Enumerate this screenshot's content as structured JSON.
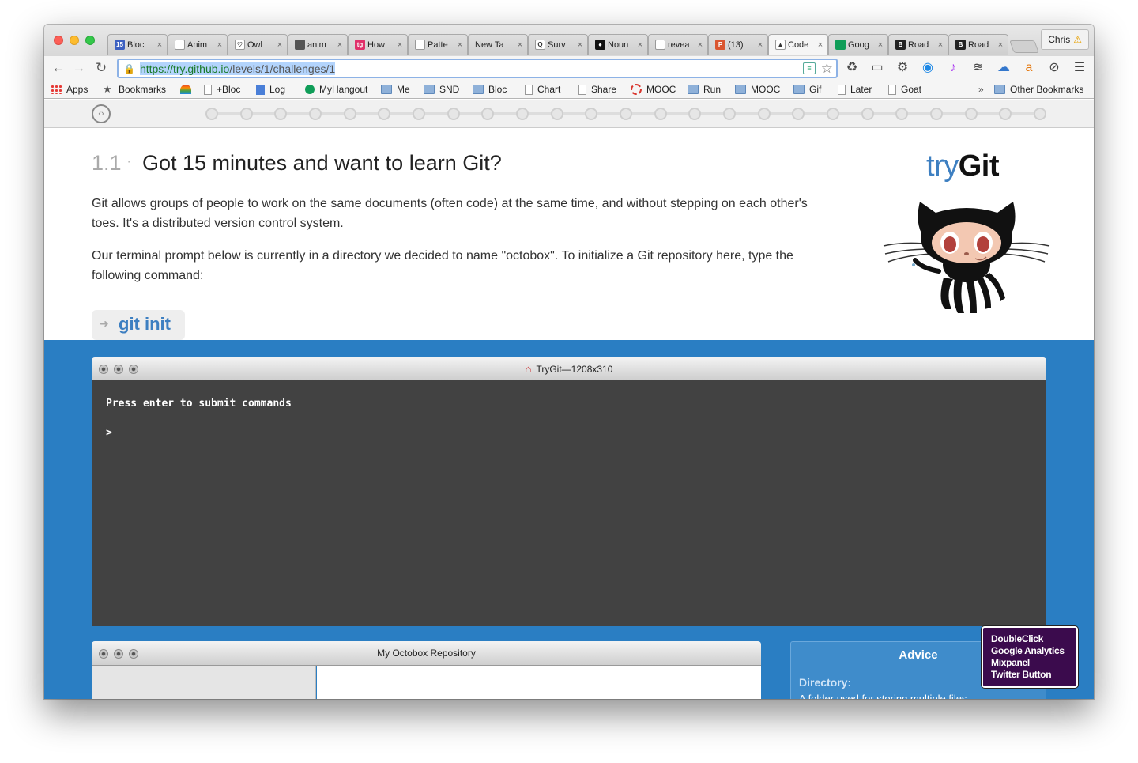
{
  "browser": {
    "tabs": [
      {
        "label": "Bloc",
        "icon": "calendar-15-icon",
        "color": "#3b5fc0",
        "glyph": "15"
      },
      {
        "label": "Anim",
        "icon": "page-icon",
        "color": "#ffffff",
        "glyph": ""
      },
      {
        "label": "Owl",
        "icon": "owl-icon",
        "color": "#ffffff",
        "glyph": "♡"
      },
      {
        "label": "anim",
        "icon": "grid-icon",
        "color": "#555555",
        "glyph": ""
      },
      {
        "label": "How",
        "icon": "tg-icon",
        "color": "#e0306a",
        "glyph": "tg"
      },
      {
        "label": "Patte",
        "icon": "page-icon",
        "color": "#ffffff",
        "glyph": ""
      },
      {
        "label": "New Ta",
        "icon": "none",
        "color": "",
        "glyph": ""
      },
      {
        "label": "Surv",
        "icon": "search-icon",
        "color": "#ffffff",
        "glyph": "Q"
      },
      {
        "label": "Noun",
        "icon": "noun-icon",
        "color": "#111111",
        "glyph": "●"
      },
      {
        "label": "revea",
        "icon": "page-icon",
        "color": "#ffffff",
        "glyph": ""
      },
      {
        "label": "(13)",
        "icon": "producthunt-icon",
        "color": "#da552f",
        "glyph": "P"
      },
      {
        "label": "Code",
        "icon": "octocat-icon",
        "color": "#ffffff",
        "glyph": "▲",
        "active": true
      },
      {
        "label": "Goog",
        "icon": "hangouts-icon",
        "color": "#0f9d58",
        "glyph": ""
      },
      {
        "label": "Road",
        "icon": "bloc-b-icon",
        "color": "#222222",
        "glyph": "B"
      },
      {
        "label": "Road",
        "icon": "bloc-b-icon",
        "color": "#222222",
        "glyph": "B"
      }
    ],
    "profile_name": "Chris",
    "url_host": "https://try.github.io",
    "url_path": "/levels/1/challenges/1",
    "bookmarks": [
      {
        "label": "Apps",
        "icon": "apps-grid-icon"
      },
      {
        "label": "Bookmarks",
        "icon": "star-icon"
      },
      {
        "label": "",
        "icon": "rainbow-icon"
      },
      {
        "label": "+Bloc",
        "icon": "page-icon"
      },
      {
        "label": "Log",
        "icon": "doc-icon"
      },
      {
        "label": "MyHangout",
        "icon": "hangouts-icon"
      },
      {
        "label": "Me",
        "icon": "folder-icon"
      },
      {
        "label": "SND",
        "icon": "folder-icon"
      },
      {
        "label": "Bloc",
        "icon": "folder-icon"
      },
      {
        "label": "Chart",
        "icon": "page-icon"
      },
      {
        "label": "Share",
        "icon": "page-icon"
      },
      {
        "label": "MOOC",
        "icon": "ring-icon"
      },
      {
        "label": "Run",
        "icon": "folder-icon"
      },
      {
        "label": "MOOC",
        "icon": "folder-icon"
      },
      {
        "label": "Gif",
        "icon": "folder-icon"
      },
      {
        "label": "Later",
        "icon": "page-icon"
      },
      {
        "label": "Goat",
        "icon": "page-icon"
      }
    ],
    "overflow_chevron": "»",
    "other_bookmarks": "Other Bookmarks"
  },
  "lesson": {
    "number": "1.1",
    "separator": "·",
    "title": "Got 15 minutes and want to learn Git?",
    "para1": "Git allows groups of people to work on the same documents (often code) at the same time, and without stepping on each other's toes. It's a distributed version control system.",
    "para2": "Our terminal prompt below is currently in a directory we decided to name \"octobox\". To initialize a Git repository here, type the following command:",
    "command": "git init",
    "brand_try": "try",
    "brand_git": "Git",
    "progress_steps": 25
  },
  "terminal": {
    "title": "TryGit—1208x310",
    "message": "Press enter to submit commands",
    "prompt": ">"
  },
  "repo": {
    "title": "My Octobox Repository"
  },
  "advice": {
    "title": "Advice",
    "term": "Directory:",
    "desc": "A folder used for storing multiple files."
  },
  "trackers": [
    "DoubleClick",
    "Google Analytics",
    "Mixpanel",
    "Twitter Button"
  ]
}
